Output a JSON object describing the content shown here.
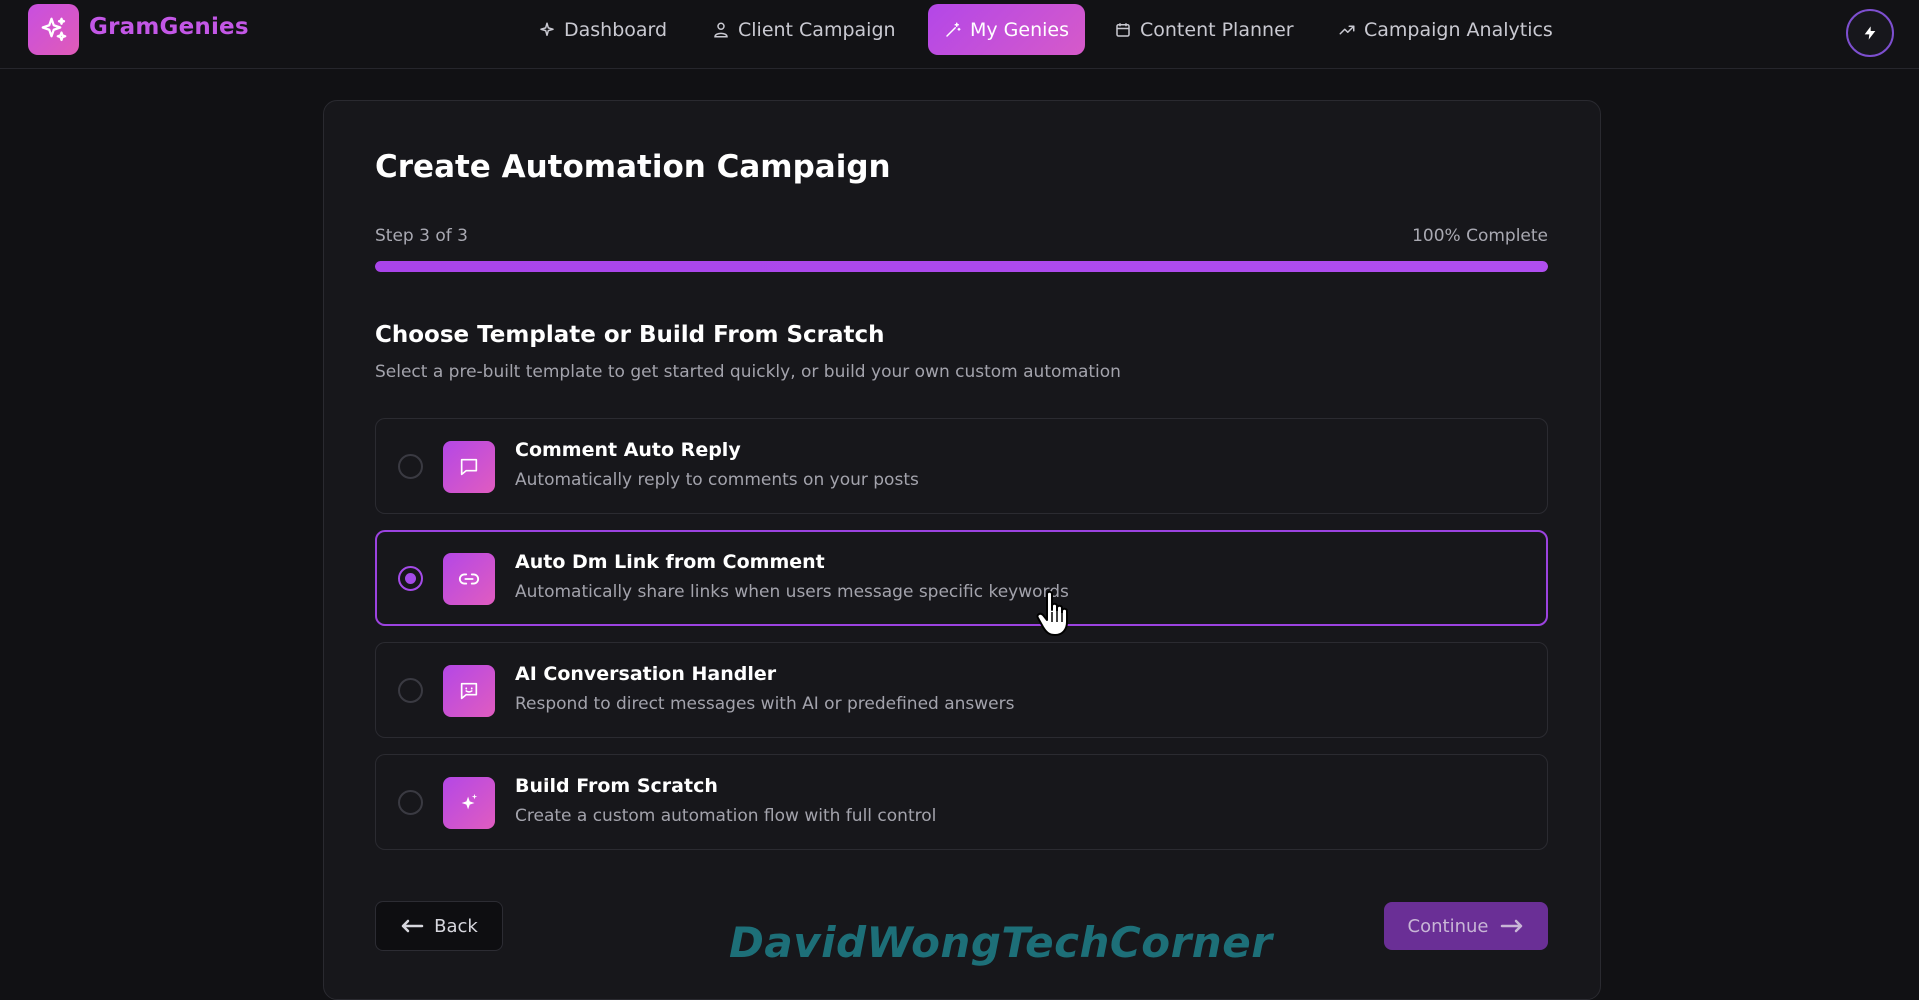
{
  "app": {
    "brand": "GramGenies"
  },
  "nav": {
    "items": [
      {
        "label": "Dashboard",
        "icon": "sparkle-icon"
      },
      {
        "label": "Client Campaign",
        "icon": "user-icon"
      },
      {
        "label": "My Genies",
        "icon": "magic-wand-icon",
        "active": true
      },
      {
        "label": "Content Planner",
        "icon": "calendar-icon"
      },
      {
        "label": "Campaign Analytics",
        "icon": "trend-icon"
      }
    ],
    "action_icon": "lightning-bolt-icon"
  },
  "wizard": {
    "title": "Create Automation Campaign",
    "step_text": "Step 3 of 3",
    "complete_text": "100% Complete",
    "progress_percent": 100,
    "section_title": "Choose Template or Build From Scratch",
    "section_subtitle": "Select a pre-built template to get started quickly, or build your own custom automation",
    "options": [
      {
        "title": "Comment Auto Reply",
        "description": "Automatically reply to comments on your posts",
        "icon": "chat-bubble-icon",
        "selected": false
      },
      {
        "title": "Auto Dm Link from Comment",
        "description": "Automatically share links when users message specific keywords",
        "icon": "link-icon",
        "selected": true
      },
      {
        "title": "AI Conversation Handler",
        "description": "Respond to direct messages with AI or predefined answers",
        "icon": "message-smile-icon",
        "selected": false
      },
      {
        "title": "Build From Scratch",
        "description": "Create a custom automation flow with full control",
        "icon": "sparkles-icon",
        "selected": false
      }
    ],
    "back_label": "Back",
    "continue_label": "Continue"
  },
  "watermark": "DavidWongTechCorner",
  "colors": {
    "accent": "#b04ef0",
    "brand": "#c357e6",
    "background": "#111114",
    "card": "#17171b"
  }
}
